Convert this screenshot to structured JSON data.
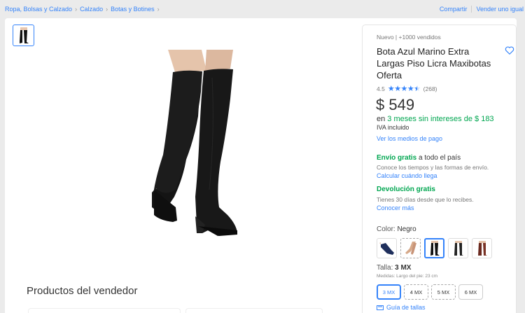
{
  "breadcrumb": {
    "items": [
      "Ropa, Bolsas y Calzado",
      "Calzado",
      "Botas y Botines"
    ]
  },
  "toplinks": {
    "share": "Compartir",
    "sell": "Vender uno igual"
  },
  "product": {
    "condition": "Nuevo  |  +1000 vendidos",
    "title": "Bota Azul Marino Extra Largas Piso Licra Maxibotas Oferta",
    "rating_value": "4.5",
    "rating_stars": 4.5,
    "rating_count": "(268)",
    "price": "$ 549",
    "installments_prefix": "en ",
    "installments_highlight": "3 meses sin intereses de $ 183",
    "iva": "IVA incluido",
    "payment_link": "Ver los medios de pago"
  },
  "shipping": {
    "title_green": "Envío gratis",
    "title_rest": " a todo el país",
    "desc": "Conoce los tiempos y las formas de envío.",
    "link": "Calcular cuándo llega"
  },
  "returns": {
    "title": "Devolución gratis",
    "desc": "Tienes 30 días desde que lo recibes.",
    "link": "Conocer más"
  },
  "variants": {
    "color_label": "Color: ",
    "color_value": "Negro",
    "swatches": [
      "navy",
      "nude",
      "black",
      "black-2",
      "brown"
    ],
    "size_label": "Talla: ",
    "size_value": "3 MX",
    "measure": "Medidas: Largo del pie: 23 cm",
    "sizes": [
      "3 MX",
      "4 MX",
      "5 MX",
      "6 MX"
    ],
    "guide": "Guía de tallas"
  },
  "seller": {
    "heading": "Productos del vendedor"
  },
  "colors": {
    "accent": "#3483fa",
    "green": "#00a650"
  },
  "icons": [
    "chevron-right-icon",
    "heart-icon",
    "star-icon",
    "ruler-icon"
  ]
}
